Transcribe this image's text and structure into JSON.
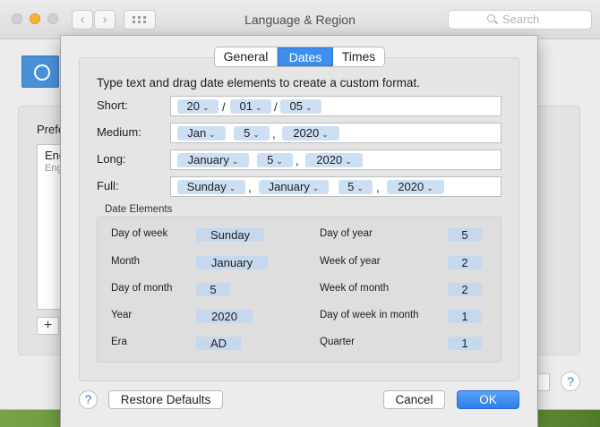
{
  "window": {
    "title": "Language & Region",
    "search_placeholder": "Search",
    "preferred_label": "Prefe",
    "list_item_1": "Eng",
    "list_item_2": "Eng",
    "add_glyph": "+",
    "help_glyph": "?"
  },
  "sheet": {
    "tabs": [
      "General",
      "Dates",
      "Times"
    ],
    "active_tab": "Dates",
    "instructions": "Type text and drag date elements to create a custom format.",
    "formats": {
      "short": {
        "label": "Short:",
        "tokens": [
          "20",
          "01",
          "05"
        ],
        "separators": [
          "/",
          "/"
        ]
      },
      "medium": {
        "label": "Medium:",
        "tokens": [
          "Jan",
          "5",
          "2020"
        ],
        "separators": [
          ","
        ]
      },
      "long": {
        "label": "Long:",
        "tokens": [
          "January",
          "5",
          "2020"
        ],
        "separators": [
          ","
        ]
      },
      "full": {
        "label": "Full:",
        "tokens": [
          "Sunday",
          "January",
          "5",
          "2020"
        ],
        "separators": [
          ",",
          ","
        ]
      }
    },
    "date_elements": {
      "title": "Date Elements",
      "left": [
        {
          "label": "Day of week",
          "value": "Sunday"
        },
        {
          "label": "Month",
          "value": "January"
        },
        {
          "label": "Day of month",
          "value": "5"
        },
        {
          "label": "Year",
          "value": "2020"
        },
        {
          "label": "Era",
          "value": "AD"
        }
      ],
      "right": [
        {
          "label": "Day of year",
          "value": "5"
        },
        {
          "label": "Week of year",
          "value": "2"
        },
        {
          "label": "Week of month",
          "value": "2"
        },
        {
          "label": "Day of week in month",
          "value": "1"
        },
        {
          "label": "Quarter",
          "value": "1"
        }
      ]
    },
    "buttons": {
      "help": "?",
      "restore": "Restore Defaults",
      "cancel": "Cancel",
      "ok": "OK"
    }
  },
  "colors": {
    "accent": "#3e8ef0",
    "token_bg": "#cddff3"
  }
}
